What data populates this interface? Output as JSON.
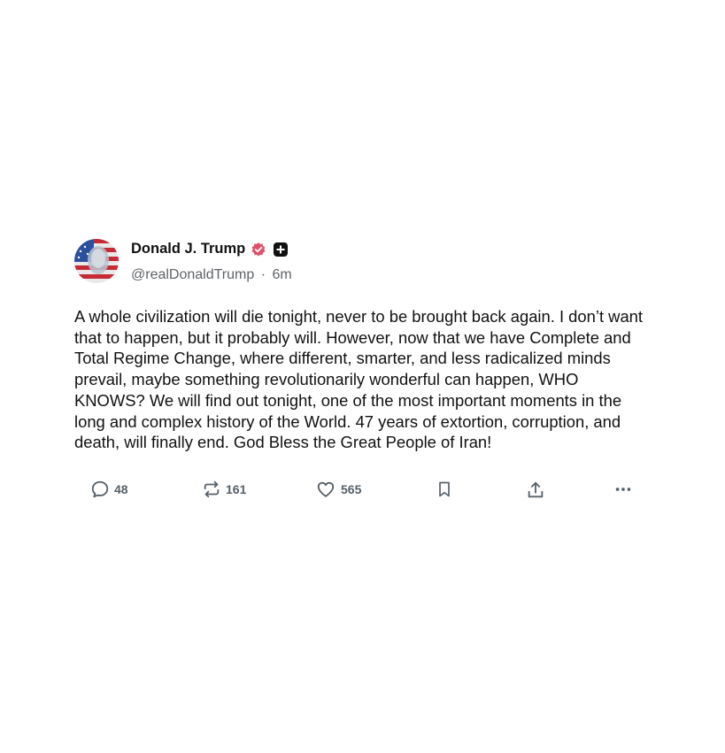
{
  "post": {
    "author": {
      "display_name": "Donald J. Trump",
      "handle": "@realDonaldTrump",
      "time_ago": "6m",
      "separator": "·",
      "verified": true
    },
    "text": "A whole civilization will die tonight, never to be brought back again. I don’t want that to happen, but it probably will. However, now that we have Complete and Total Regime Change, where different, smarter, and less radicalized minds prevail, maybe something revolutionarily wonderful can happen, WHO KNOWS? We will find out tonight, one of the most important moments in the long and complex history of the World. 47 years of extortion, corruption, and death, will finally end. God Bless the Great People of Iran!",
    "actions": {
      "replies": "48",
      "reposts": "161",
      "likes": "565"
    }
  },
  "icons": {
    "verified": "verified-badge-icon",
    "plus": "plus-badge-icon",
    "reply": "speech-bubble-icon",
    "repost": "repost-arrows-icon",
    "like": "heart-icon",
    "bookmark": "bookmark-icon",
    "share": "share-upload-icon",
    "more": "ellipsis-icon"
  },
  "colors": {
    "verified_badge": "#e0506a",
    "action_gray": "#56606a",
    "text": "#111111",
    "muted": "#5f6368"
  }
}
